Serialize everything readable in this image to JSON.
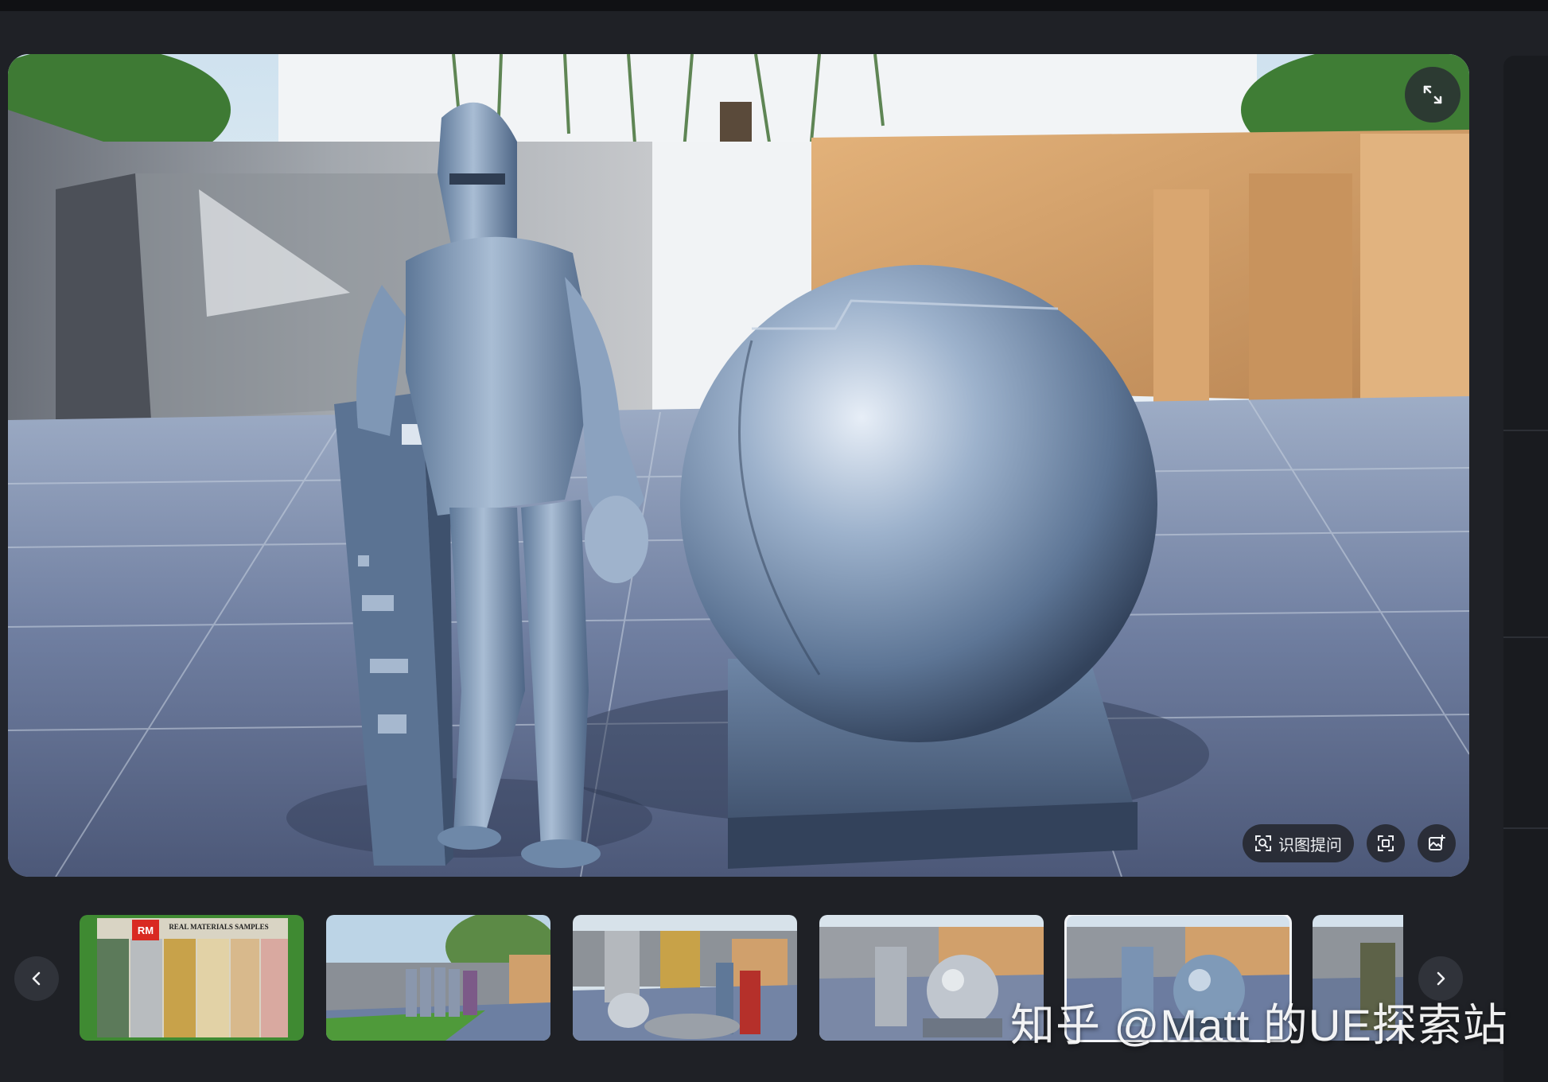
{
  "toolbar": {
    "ask_label": "识图提问",
    "icons": [
      "expand-icon",
      "scan-text-icon",
      "scan-icon",
      "image-edit-icon"
    ]
  },
  "thumbnails": [
    {
      "name": "thumb-material-samples",
      "caption": "REAL MATERIALS SAMPLES",
      "badge": "RM"
    },
    {
      "name": "thumb-knights-garden",
      "caption": ""
    },
    {
      "name": "thumb-props-scene",
      "caption": ""
    },
    {
      "name": "thumb-silver-knight-sphere",
      "caption": ""
    },
    {
      "name": "thumb-blue-knight-sphere",
      "caption": "",
      "active": true
    },
    {
      "name": "thumb-dark-knight",
      "caption": ""
    }
  ],
  "navigation": {
    "prev_icon": "chevron-left-icon",
    "next_icon": "chevron-right-icon"
  },
  "watermark": {
    "text": "知乎 @Matt 的UE探索站"
  },
  "colors": {
    "background": "#1f2126",
    "metal_blue": "#7f9ab8",
    "sandstone": "#c99a64"
  }
}
